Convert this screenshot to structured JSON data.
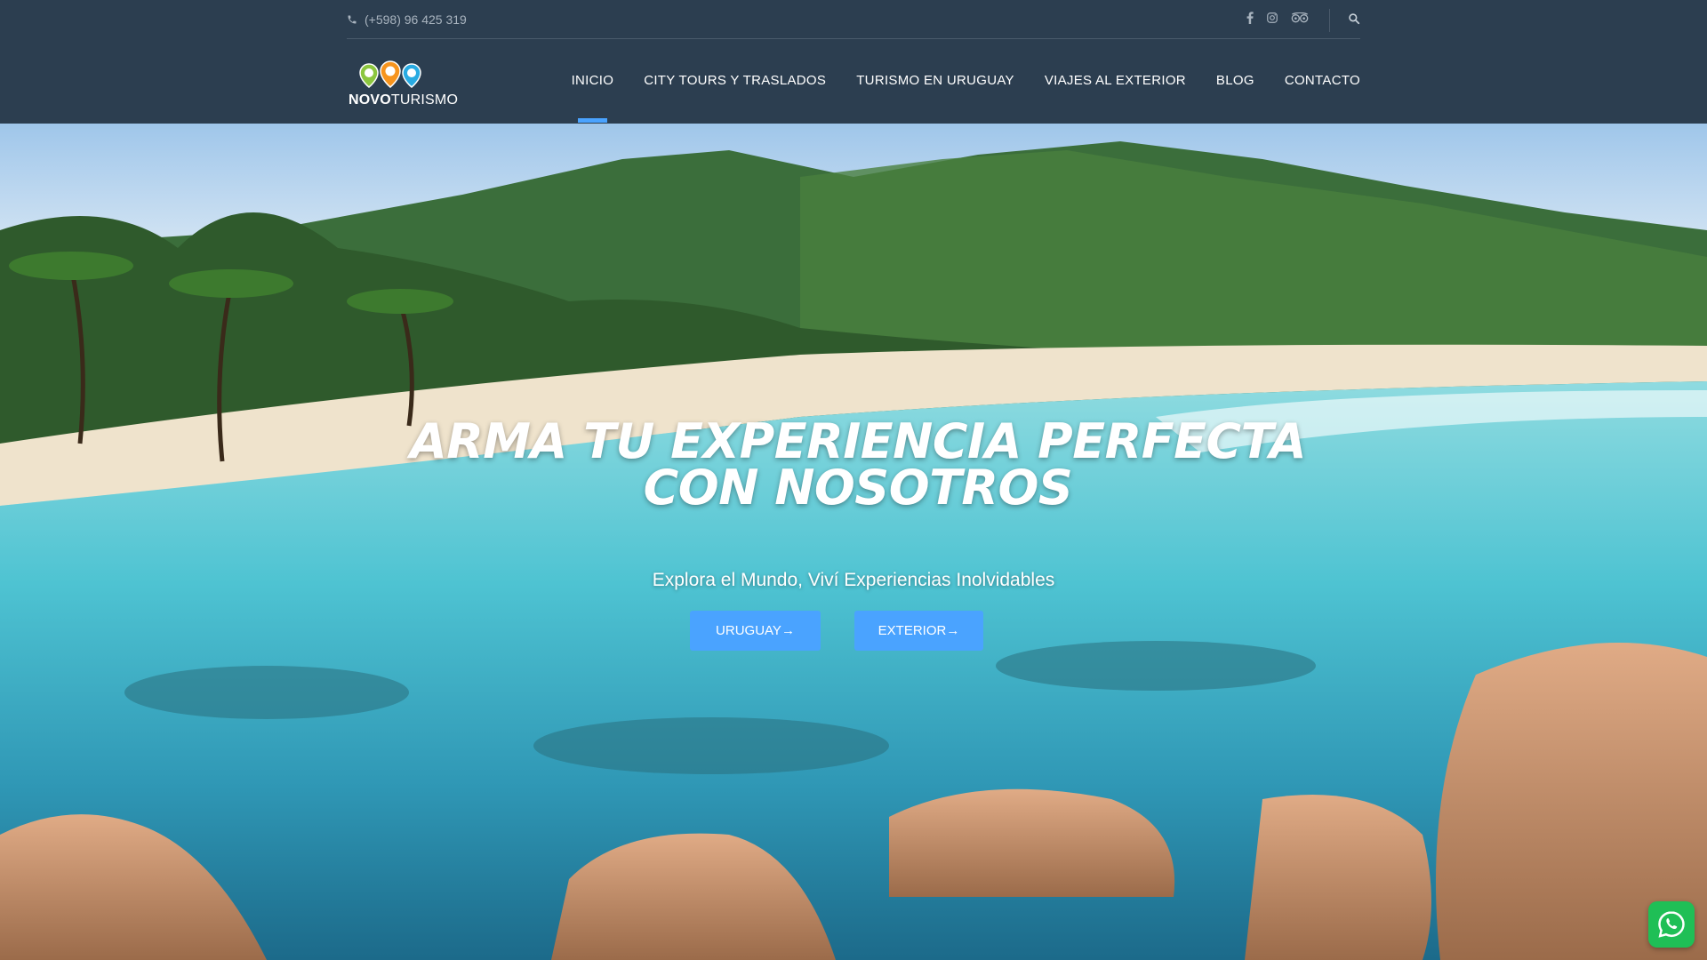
{
  "topbar": {
    "phone": "(+598) 96 425 319",
    "social_icons": [
      "facebook-icon",
      "instagram-icon",
      "tripadvisor-icon"
    ],
    "search_icon": "search-icon"
  },
  "logo": {
    "wordmark_bold": "NOVO",
    "wordmark_rest": "TURISMO",
    "pin_colors": [
      "#8cc63f",
      "#f7941d",
      "#29abe2"
    ]
  },
  "nav": {
    "items": [
      {
        "label": "INICIO",
        "active": true
      },
      {
        "label": "CITY TOURS Y TRASLADOS",
        "active": false
      },
      {
        "label": "TURISMO EN URUGUAY",
        "active": false
      },
      {
        "label": "VIAJES AL EXTERIOR",
        "active": false
      },
      {
        "label": "BLOG",
        "active": false
      },
      {
        "label": "CONTACTO",
        "active": false
      }
    ]
  },
  "hero": {
    "title": "ARMA TU EXPERIENCIA PERFECTA CON NOSOTROS",
    "subtitle": "Explora el Mundo, Viví Experiencias Inolvidables",
    "buttons": [
      {
        "label": "URUGUAY→"
      },
      {
        "label": "EXTERIOR→"
      }
    ]
  },
  "colors": {
    "header_bg": "#2c3e50",
    "accent": "#4aa3ff",
    "whatsapp": "#1fbf56"
  },
  "floating": {
    "whatsapp_icon": "whatsapp-icon"
  }
}
